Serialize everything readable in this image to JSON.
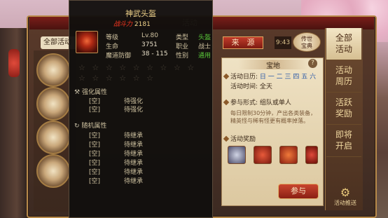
{
  "window_tab": "活动",
  "left": {
    "tab_label": "全部活动"
  },
  "right_tabs": [
    {
      "label": "全部\n活动"
    },
    {
      "label": "活动\n周历"
    },
    {
      "label": "活跃\n奖励"
    },
    {
      "label": "即将\n开启"
    }
  ],
  "source_button": "来　源",
  "time_badge": "9:43",
  "legend_button": "传世\n宝典",
  "detail": {
    "title": "宝地",
    "help": "?",
    "schedule_label": "活动日历:",
    "schedule_days": "日 一 二 三 四 五 六",
    "time_label": "活动时间:",
    "time_value": "全天",
    "form_label": "参与形式:",
    "form_value": "组队或单人",
    "desc1": "每日限制30分钟，产出各类装备，",
    "desc2": "精英怪与稀有怪更有概率掉落。",
    "reward_label": "活动奖励",
    "join_button": "参与"
  },
  "push_button": "活动推送",
  "tooltip": {
    "title": "神武头盔",
    "power_label": "战斗力",
    "power_value": "2181",
    "level_label": "等级",
    "level_value": "Lv.80",
    "type_label": "类型",
    "type_value": "头盔",
    "hp_label": "生命",
    "hp_value": "3751",
    "job_label": "职业",
    "job_value": "战士",
    "mdef_label": "魔道防御",
    "mdef_value": "38 - 115",
    "gender_label": "性别",
    "gender_value": "通用",
    "enhance_header": "强化属性",
    "random_header": "随机属性",
    "empty": "[空]",
    "to_enhance": "待强化",
    "to_inherit": "待继承"
  },
  "colors": {
    "accent_red": "#b02a1a",
    "gold": "#f0d28a",
    "green": "#5ac83a",
    "panel": "#efe2c4"
  }
}
